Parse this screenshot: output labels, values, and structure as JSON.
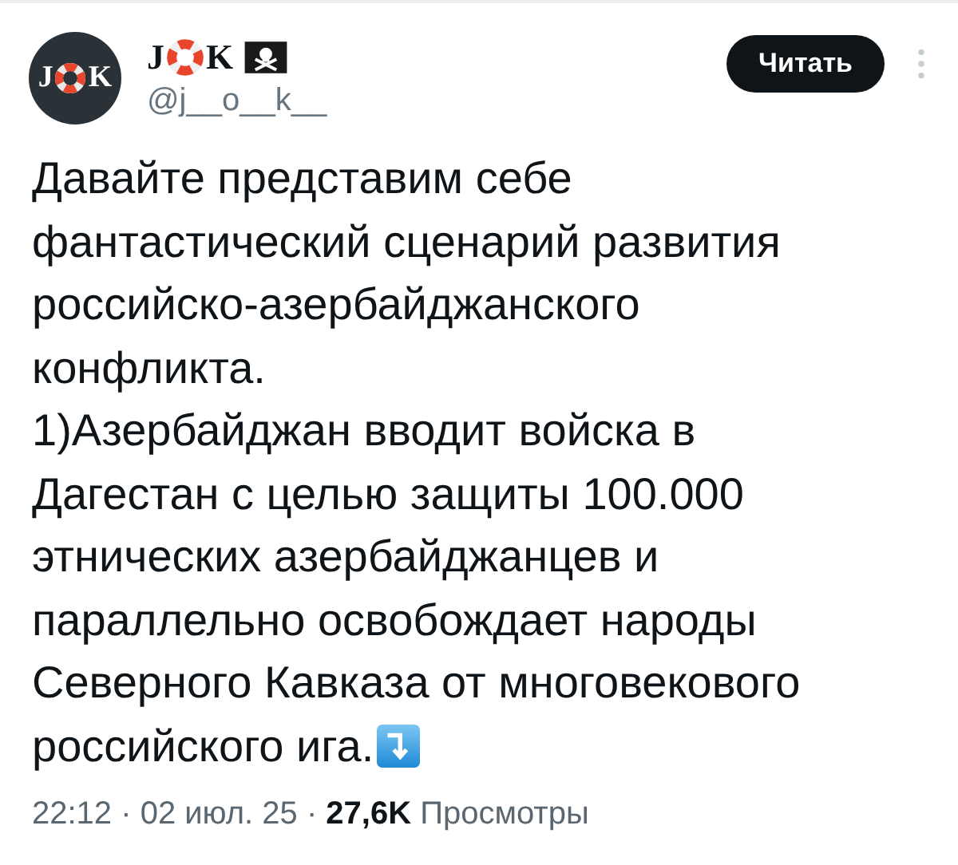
{
  "author": {
    "avatar_letters": [
      "J",
      "K"
    ],
    "name_start": "J",
    "name_end": "K",
    "handle": "@j__o__k__"
  },
  "follow_button": {
    "label": "Читать"
  },
  "post": {
    "paragraphs": [
      "Давайте представим себе\nфантастический сценарий развития\nроссийско-азербайджанского\nконфликта.",
      "1)Азербайджан вводит войска в\nДагестан с целью защиты 100.000\nэтнических азербайджанцев и\nпараллельно освобождает народы\nСеверного Кавказа от многовекового"
    ],
    "last_line": "российского ига."
  },
  "meta": "22:12 · 02 июл. 25 · **27,6K** Просмотры"
}
